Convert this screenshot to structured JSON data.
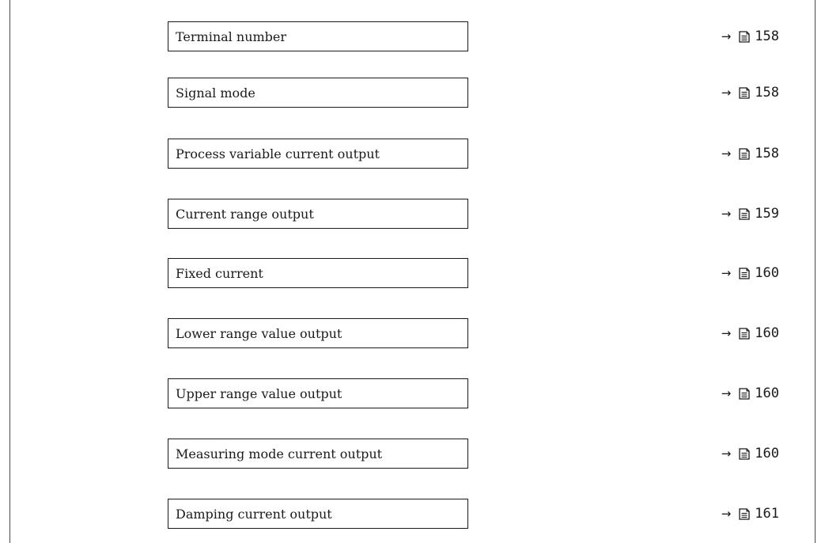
{
  "parameters": [
    {
      "label": "Terminal number",
      "arrow": "→",
      "page_icon": "page-reference-icon",
      "page": "158"
    },
    {
      "label": "Signal mode",
      "arrow": "→",
      "page_icon": "page-reference-icon",
      "page": "158"
    },
    {
      "label": "Process variable current output",
      "arrow": "→",
      "page_icon": "page-reference-icon",
      "page": "158"
    },
    {
      "label": "Current range output",
      "arrow": "→",
      "page_icon": "page-reference-icon",
      "page": "159"
    },
    {
      "label": "Fixed current",
      "arrow": "→",
      "page_icon": "page-reference-icon",
      "page": "160"
    },
    {
      "label": "Lower range value output",
      "arrow": "→",
      "page_icon": "page-reference-icon",
      "page": "160"
    },
    {
      "label": "Upper range value output",
      "arrow": "→",
      "page_icon": "page-reference-icon",
      "page": "160"
    },
    {
      "label": "Measuring mode current output",
      "arrow": "→",
      "page_icon": "page-reference-icon",
      "page": "160"
    },
    {
      "label": "Damping current output",
      "arrow": "→",
      "page_icon": "page-reference-icon",
      "page": "161"
    }
  ]
}
